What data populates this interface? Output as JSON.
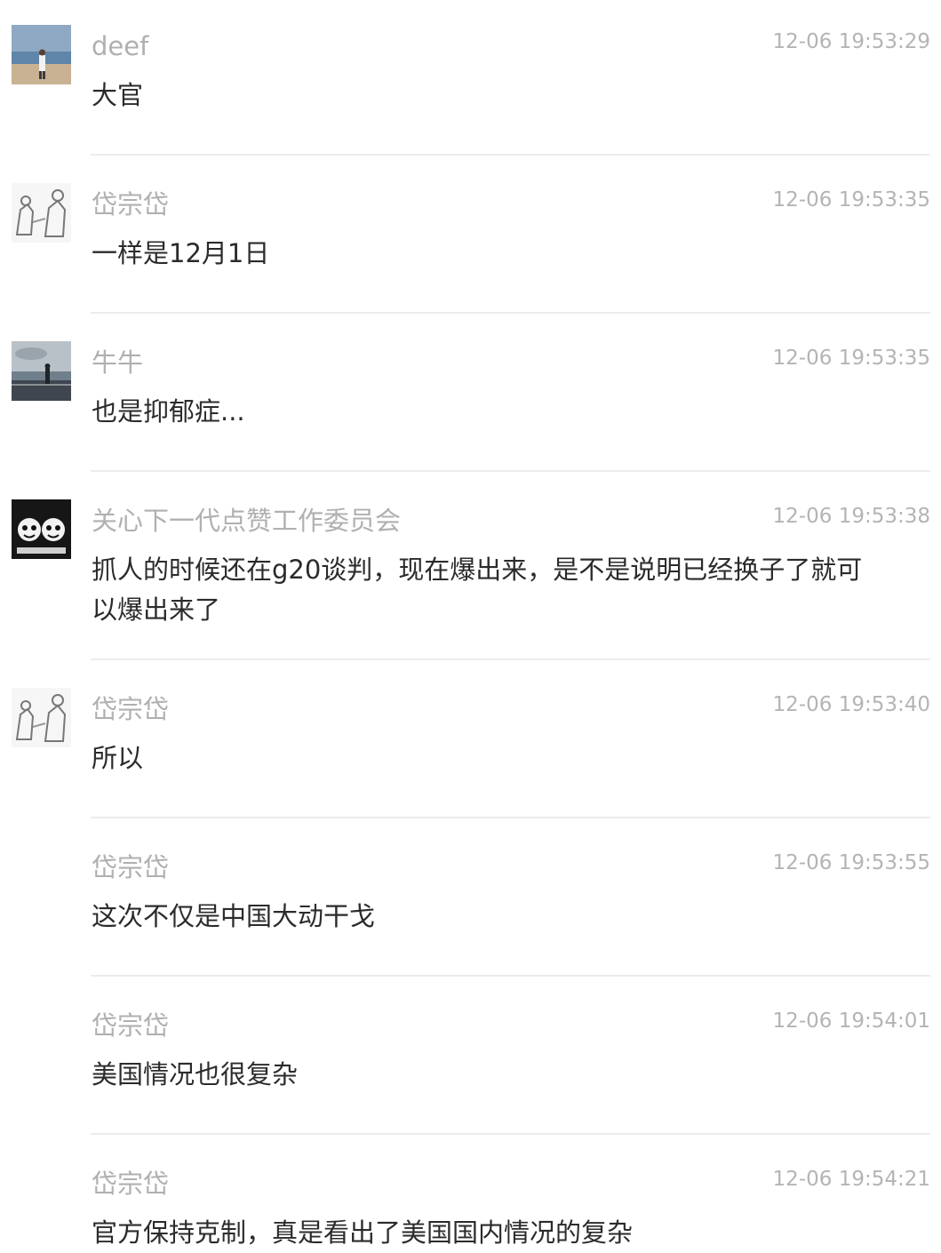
{
  "messages": [
    {
      "user": "deef",
      "time": "12-06 19:53:29",
      "text": "大官",
      "avatar": "beach-photo-avatar"
    },
    {
      "user": "岱宗岱",
      "time": "12-06 19:53:35",
      "text": "一样是12月1日",
      "avatar": "sketch-figures-avatar"
    },
    {
      "user": "牛牛",
      "time": "12-06 19:53:35",
      "text": "也是抑郁症...",
      "avatar": "seaside-photo-avatar"
    },
    {
      "user": "关心下一代点赞工作委员会",
      "time": "12-06 19:53:38",
      "text": "抓人的时候还在g20谈判，现在爆出来，是不是说明已经换子了就可以爆出来了",
      "avatar": "cartoon-faces-avatar"
    },
    {
      "user": "岱宗岱",
      "time": "12-06 19:53:40",
      "text": "所以",
      "avatar": "sketch-figures-avatar"
    },
    {
      "user": "岱宗岱",
      "time": "12-06 19:53:55",
      "text": "这次不仅是中国大动干戈",
      "avatar": ""
    },
    {
      "user": "岱宗岱",
      "time": "12-06 19:54:01",
      "text": "美国情况也很复杂",
      "avatar": ""
    },
    {
      "user": "岱宗岱",
      "time": "12-06 19:54:21",
      "text": "官方保持克制，真是看出了美国国内情况的复杂",
      "avatar": ""
    }
  ]
}
